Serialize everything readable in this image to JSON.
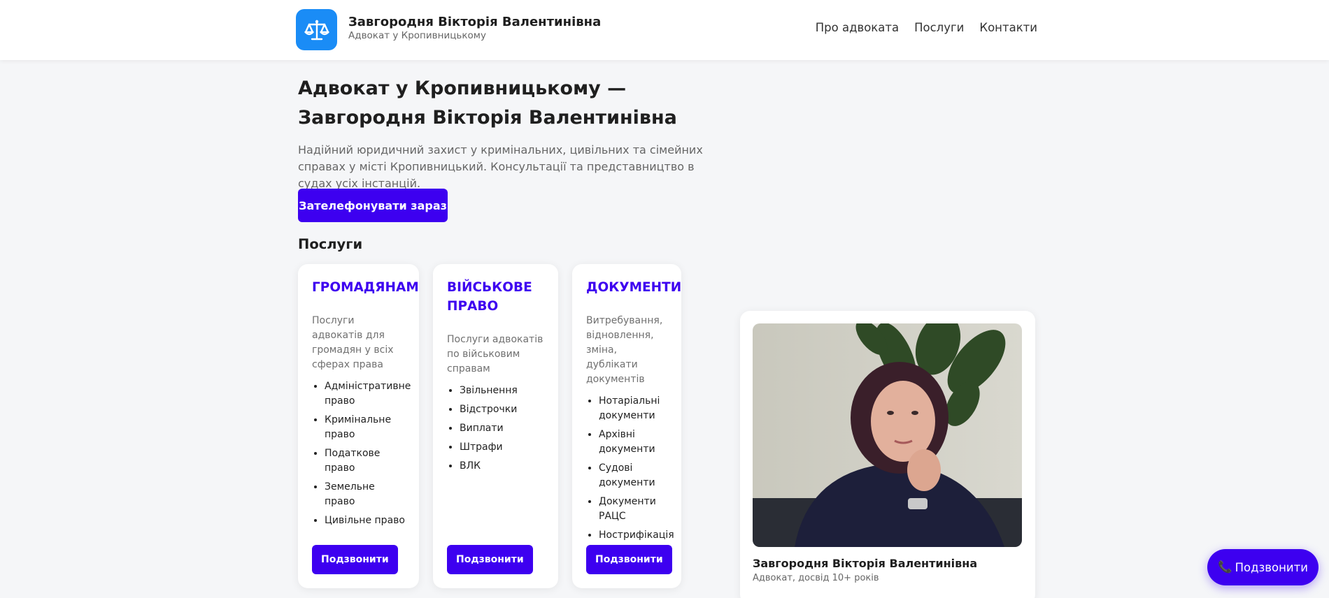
{
  "header": {
    "logo_icon": "scales-icon",
    "title": "Завгородня Вікторія Валентинівна",
    "subtitle": "Адвокат у Кропивницькому",
    "nav": [
      {
        "label": "Про адвоката"
      },
      {
        "label": "Послуги"
      },
      {
        "label": "Контакти"
      }
    ]
  },
  "hero": {
    "title": "Адвокат у Кропивницькому — Завгородня Вікторія Валентинівна",
    "description": "Надійний юридичний захист у кримінальних, цивільних та сімейних справах у місті Кропивницький. Консультації та представництво в судах усіх інстанцій.",
    "cta_label": "Зателефонувати зараз"
  },
  "services": {
    "heading": "Послуги",
    "cards": [
      {
        "title": "ГРОМАДЯНАМ",
        "description": "Послуги адвокатів для громадян у всіх сферах права",
        "items": [
          "Адміністративне право",
          "Кримінальне право",
          "Податкове право",
          "Земельне право",
          "Цивільне право"
        ],
        "button": "Подзвонити"
      },
      {
        "title": "ВІЙСЬКОВЕ ПРАВО",
        "description": "Послуги адвокатів по військовим справам",
        "items": [
          "Звільнення",
          "Відстрочки",
          "Виплати",
          "Штрафи",
          "ВЛК"
        ],
        "button": "Подзвонити"
      },
      {
        "title": "ДОКУМЕНТИ",
        "description": "Витребування, відновлення, зміна, дублікати документів",
        "items": [
          "Нотаріальні документи",
          "Архівні документи",
          "Судові документи",
          "Документи РАЦС",
          "Нострифікація"
        ],
        "button": "Подзвонити"
      }
    ]
  },
  "profile": {
    "name": "Завгородня Вікторія Валентинівна",
    "role": "Адвокат, досвід 10+ років"
  },
  "floating_call": {
    "icon": "phone-icon",
    "label": "Подзвонити"
  },
  "colors": {
    "accent": "#3d00f0",
    "logo_bg": "#1a8cf6",
    "page_bg": "#f5f6f8"
  }
}
